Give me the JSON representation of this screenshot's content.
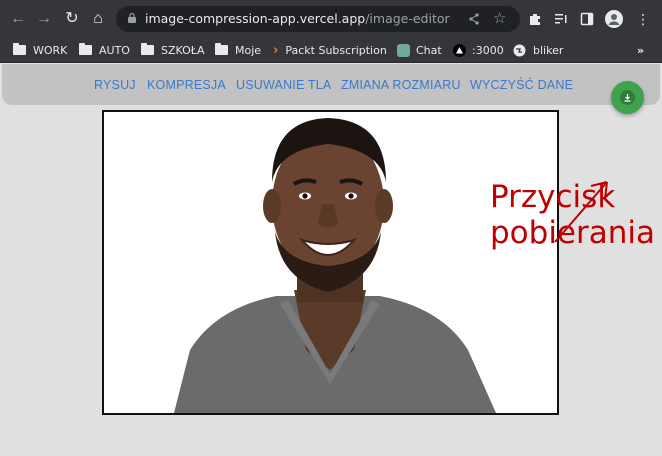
{
  "browser": {
    "url_host": "image-compression-app.vercel.app",
    "url_path": "/image-editor",
    "icons": [
      "back-icon",
      "forward-icon",
      "reload-icon",
      "home-icon",
      "lock-icon",
      "share-icon",
      "star-icon",
      "extensions-icon",
      "media-icon",
      "sidepanel-icon",
      "profile-icon",
      "menu-icon"
    ]
  },
  "bookmarks": [
    {
      "label": "WORK",
      "icon": "folder-icon"
    },
    {
      "label": "AUTO",
      "icon": "folder-icon"
    },
    {
      "label": "SZKOŁA",
      "icon": "folder-icon"
    },
    {
      "label": "Moje",
      "icon": "folder-icon"
    },
    {
      "label": "Packt Subscription",
      "icon": "packt-icon"
    },
    {
      "label": "Chat",
      "icon": "chat-icon"
    },
    {
      "label": ":3000",
      "icon": "triangle-icon"
    },
    {
      "label": "bliker",
      "icon": "globe-icon"
    }
  ],
  "app": {
    "tabs": [
      "RYSUJ",
      "KOMPRESJA",
      "USUWANIE TLA",
      "ZMIANA ROZMIARU",
      "WYCZYŚĆ DANE"
    ],
    "download_icon": "download-icon",
    "accent": "#3b78c8",
    "download_color": "#3fa34d"
  },
  "annotation": {
    "text": "Przycisk\npobierania",
    "color": "#c00000"
  }
}
